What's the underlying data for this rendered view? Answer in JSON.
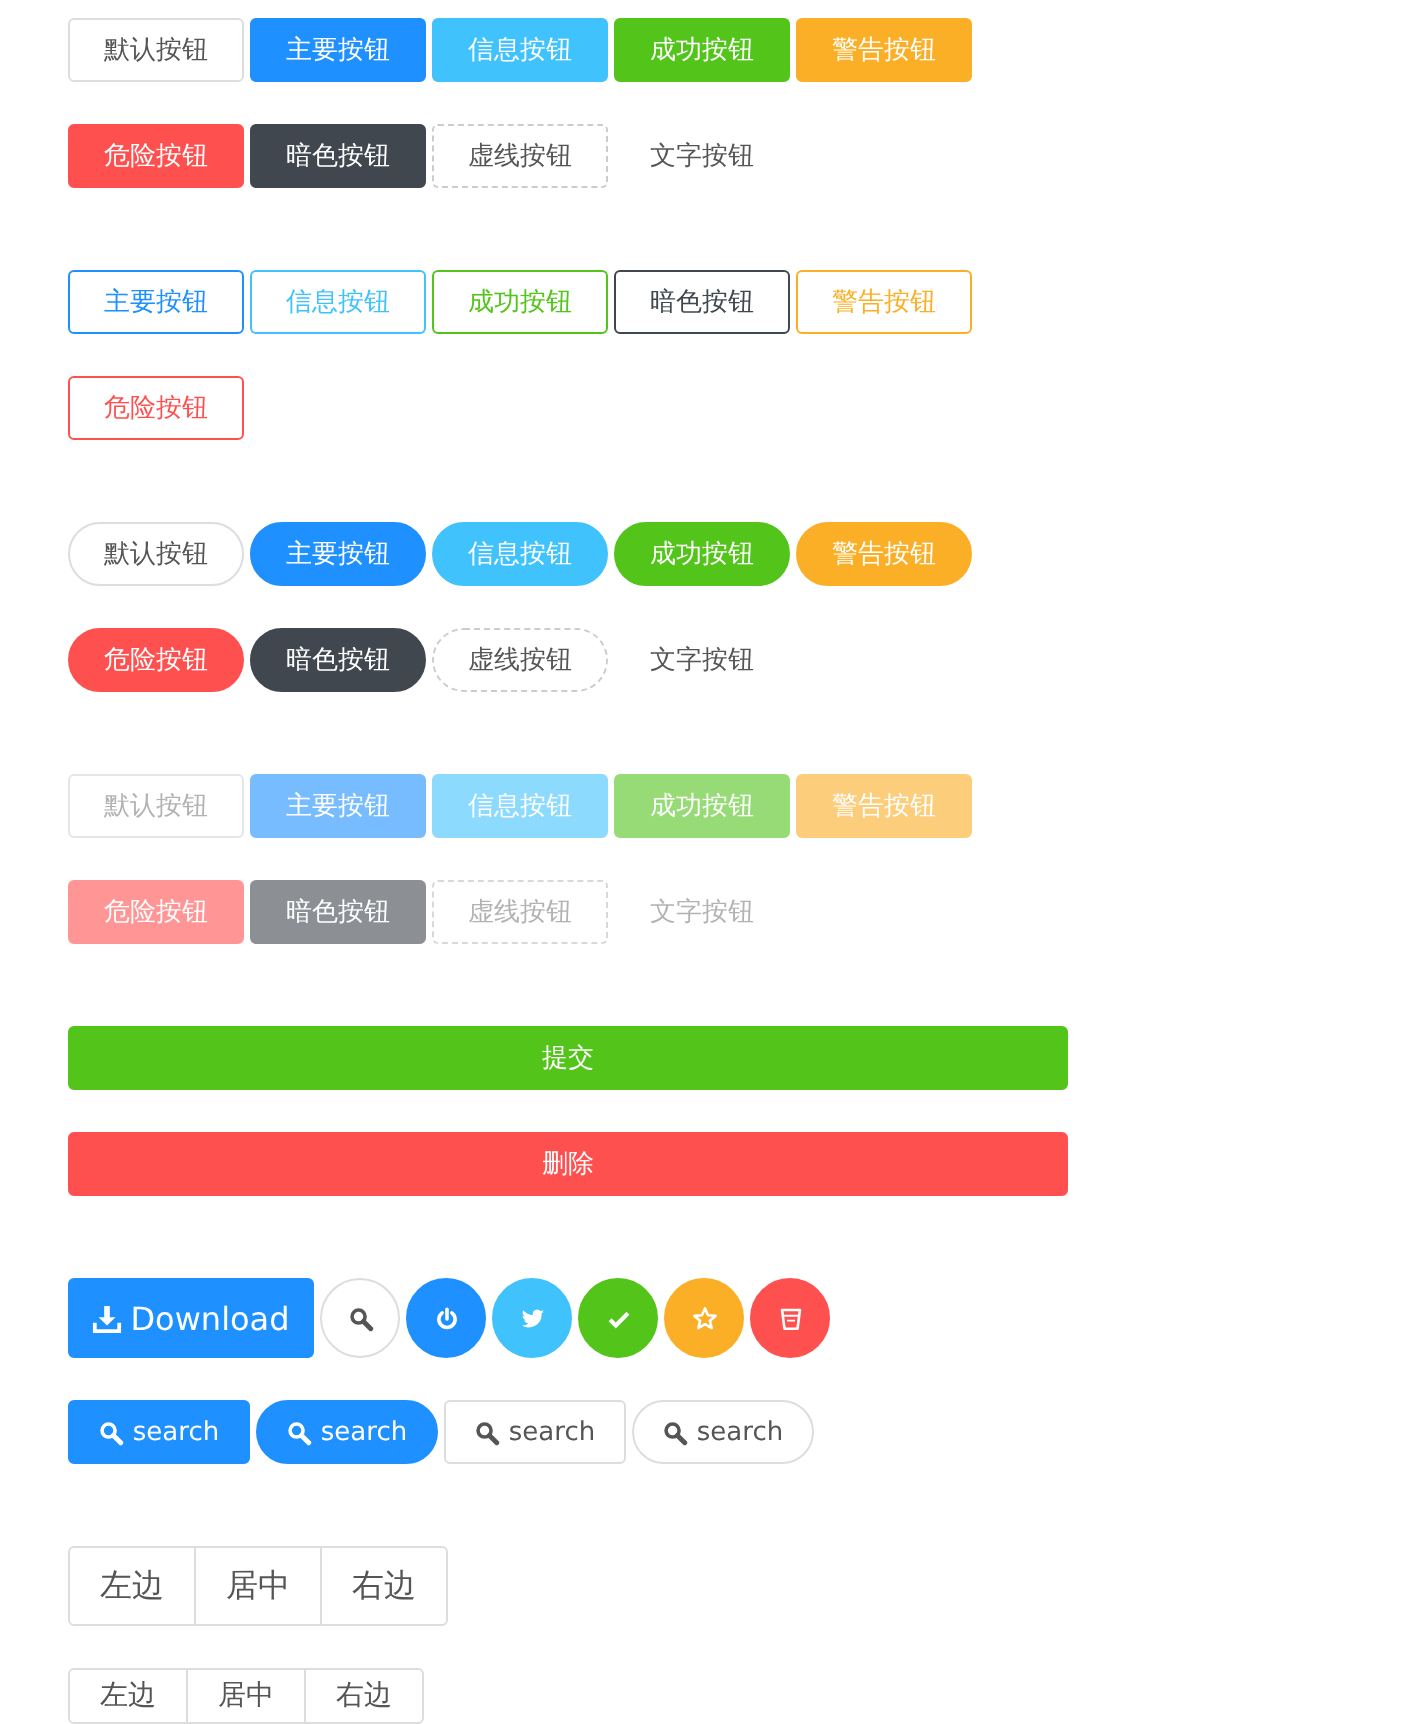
{
  "sections": [
    {
      "kind": "buttons",
      "plain": false,
      "round": false,
      "disabled": false,
      "rows": [
        [
          {
            "label": "默认按钮",
            "kind": "default"
          },
          {
            "label": "主要按钮",
            "kind": "primary"
          },
          {
            "label": "信息按钮",
            "kind": "info"
          },
          {
            "label": "成功按钮",
            "kind": "success"
          },
          {
            "label": "警告按钮",
            "kind": "warning"
          }
        ],
        [
          {
            "label": "危险按钮",
            "kind": "danger"
          },
          {
            "label": "暗色按钮",
            "kind": "dark"
          },
          {
            "label": "虚线按钮",
            "kind": "dashed"
          },
          {
            "label": "文字按钮",
            "kind": "text"
          }
        ]
      ]
    },
    {
      "kind": "buttons",
      "plain": true,
      "round": false,
      "disabled": false,
      "rows": [
        [
          {
            "label": "主要按钮",
            "kind": "primary"
          },
          {
            "label": "信息按钮",
            "kind": "info"
          },
          {
            "label": "成功按钮",
            "kind": "success"
          },
          {
            "label": "暗色按钮",
            "kind": "dark"
          },
          {
            "label": "警告按钮",
            "kind": "warning"
          }
        ],
        [
          {
            "label": "危险按钮",
            "kind": "danger"
          }
        ]
      ]
    },
    {
      "kind": "buttons",
      "plain": false,
      "round": true,
      "disabled": false,
      "rows": [
        [
          {
            "label": "默认按钮",
            "kind": "default"
          },
          {
            "label": "主要按钮",
            "kind": "primary"
          },
          {
            "label": "信息按钮",
            "kind": "info"
          },
          {
            "label": "成功按钮",
            "kind": "success"
          },
          {
            "label": "警告按钮",
            "kind": "warning"
          }
        ],
        [
          {
            "label": "危险按钮",
            "kind": "danger"
          },
          {
            "label": "暗色按钮",
            "kind": "dark"
          },
          {
            "label": "虚线按钮",
            "kind": "dashed"
          },
          {
            "label": "文字按钮",
            "kind": "text"
          }
        ]
      ]
    },
    {
      "kind": "buttons",
      "plain": false,
      "round": false,
      "disabled": true,
      "rows": [
        [
          {
            "label": "默认按钮",
            "kind": "default"
          },
          {
            "label": "主要按钮",
            "kind": "primary"
          },
          {
            "label": "信息按钮",
            "kind": "info"
          },
          {
            "label": "成功按钮",
            "kind": "success"
          },
          {
            "label": "警告按钮",
            "kind": "warning"
          }
        ],
        [
          {
            "label": "危险按钮",
            "kind": "danger"
          },
          {
            "label": "暗色按钮",
            "kind": "dark"
          },
          {
            "label": "虚线按钮",
            "kind": "dashed"
          },
          {
            "label": "文字按钮",
            "kind": "text"
          }
        ]
      ]
    },
    {
      "kind": "block",
      "buttons": [
        {
          "label": "提交",
          "kind": "success"
        },
        {
          "label": "删除",
          "kind": "danger"
        }
      ]
    },
    {
      "kind": "icons",
      "rows": [
        [
          {
            "kind": "primary",
            "label": "Download"
          },
          {
            "kind": "default"
          },
          {
            "kind": "primary"
          },
          {
            "kind": "info"
          },
          {
            "kind": "success"
          },
          {
            "kind": "warning"
          },
          {
            "kind": "danger"
          }
        ],
        [
          {
            "kind": "primary",
            "label": "search",
            "round": false
          },
          {
            "kind": "primary",
            "label": "search",
            "round": true
          },
          {
            "kind": "default",
            "label": "search",
            "round": false
          },
          {
            "kind": "default",
            "label": "search",
            "round": true
          }
        ]
      ]
    },
    {
      "kind": "group-large",
      "buttons": [
        "左边",
        "居中",
        "右边"
      ]
    },
    {
      "kind": "group-small",
      "buttons": [
        "左边",
        "居中",
        "右边"
      ]
    }
  ]
}
